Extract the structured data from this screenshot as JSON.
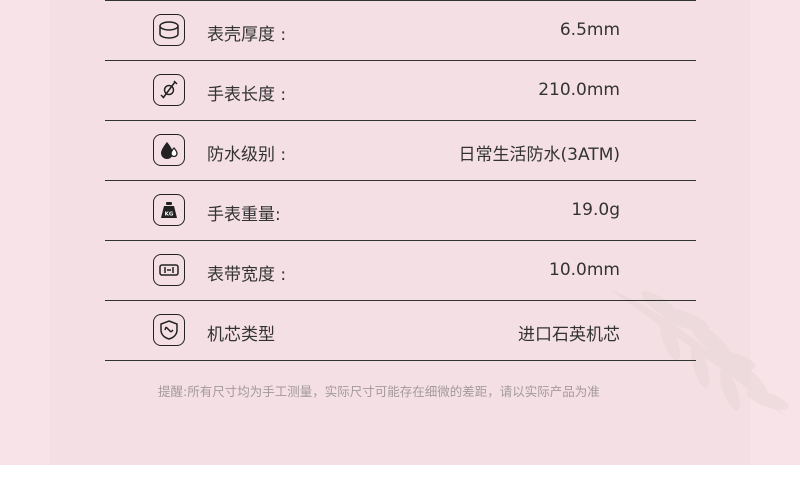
{
  "specs": [
    {
      "icon": "watch-case-icon",
      "label": "表壳厚度 :",
      "value": "6.5mm"
    },
    {
      "icon": "strap-length-icon",
      "label": "手表长度 :",
      "value": "210.0mm"
    },
    {
      "icon": "water-drop-icon",
      "label": "防水级别 :",
      "value": "日常生活防水(3ATM)"
    },
    {
      "icon": "weight-kg-icon",
      "label": "手表重量:",
      "value": "19.0g"
    },
    {
      "icon": "strap-width-icon",
      "label": "表带宽度 :",
      "value": "10.0mm"
    },
    {
      "icon": "movement-icon",
      "label": "机芯类型",
      "value": "进口石英机芯"
    }
  ],
  "note": "提醒:所有尺寸均为手工测量，实际尺寸可能存在细微的差距，请以实际产品为准",
  "colors": {
    "background": "#f8e4e8",
    "panel": "#f4dfe4",
    "line": "#333333",
    "text": "#333333",
    "note": "#a39a9e"
  }
}
